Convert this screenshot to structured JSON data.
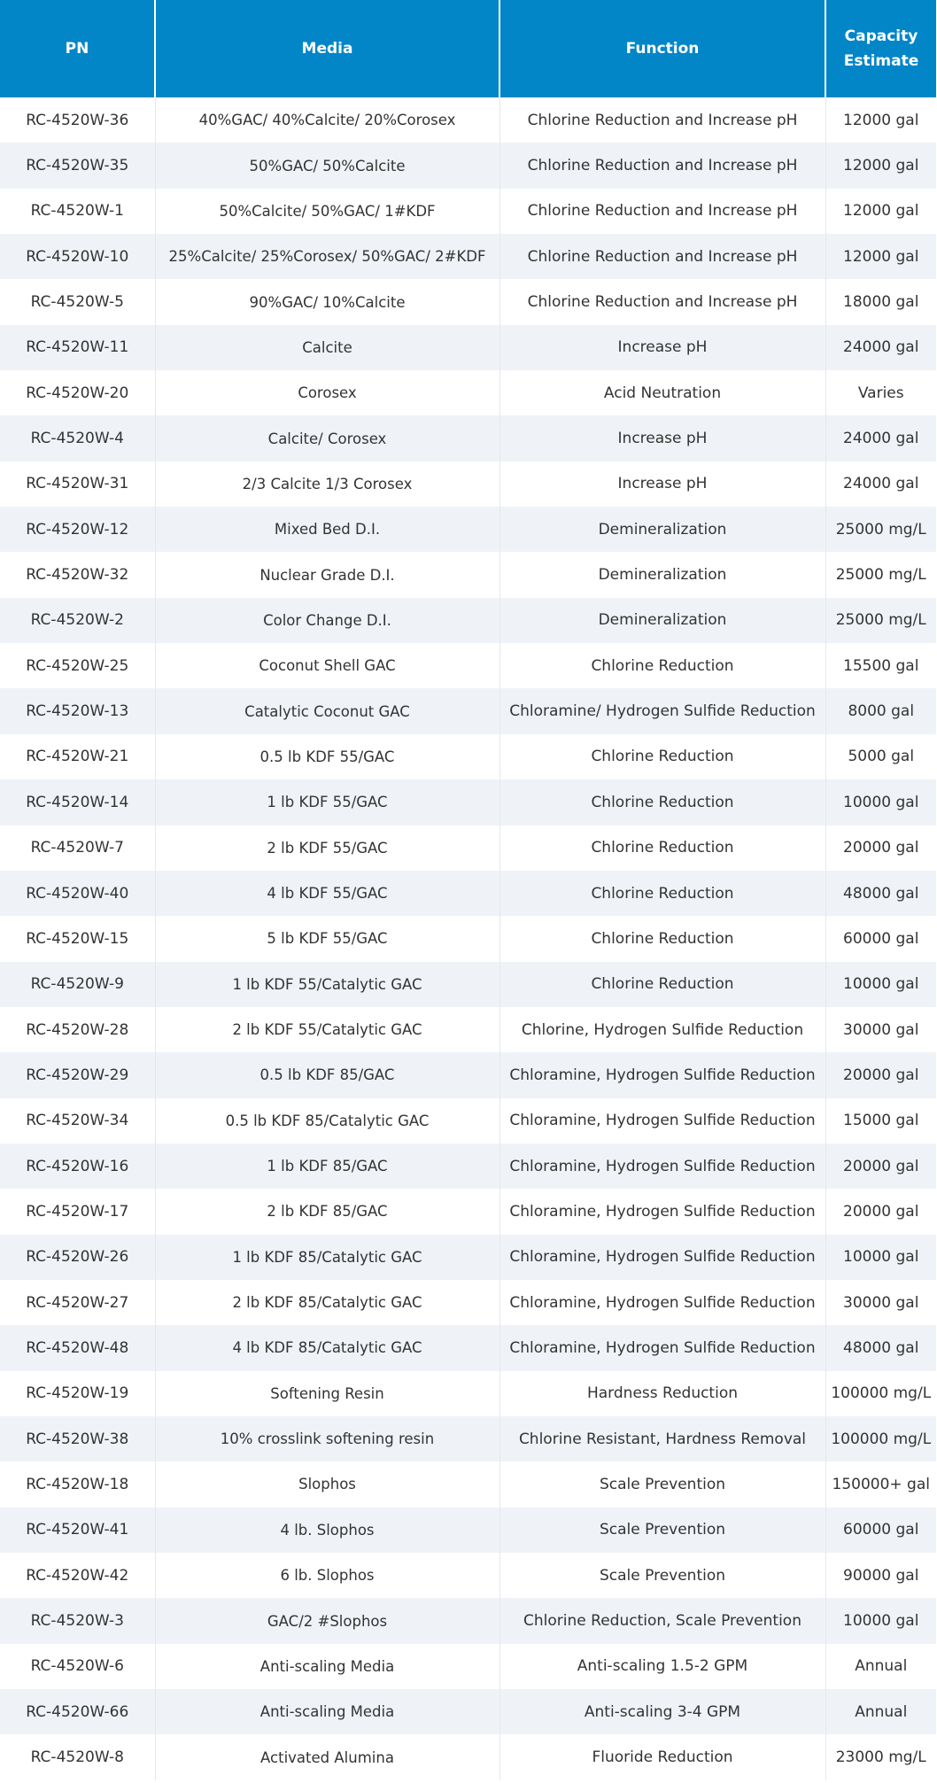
{
  "table": {
    "headers": {
      "pn": "PN",
      "media": "Media",
      "function": "Function",
      "capacity_line1": "Capacity",
      "capacity_line2": "Estimate"
    },
    "rows": [
      {
        "pn": "RC-4520W-36",
        "media": "40%GAC/ 40%Calcite/ 20%Corosex",
        "function": "Chlorine Reduction and Increase pH",
        "capacity": "12000 gal"
      },
      {
        "pn": "RC-4520W-35",
        "media": "50%GAC/ 50%Calcite",
        "function": "Chlorine Reduction and Increase pH",
        "capacity": "12000 gal"
      },
      {
        "pn": "RC-4520W-1",
        "media": "50%Calcite/ 50%GAC/ 1#KDF",
        "function": "Chlorine Reduction and Increase pH",
        "capacity": "12000 gal"
      },
      {
        "pn": "RC-4520W-10",
        "media": "25%Calcite/ 25%Corosex/ 50%GAC/ 2#KDF",
        "function": "Chlorine Reduction and Increase pH",
        "capacity": "12000 gal"
      },
      {
        "pn": "RC-4520W-5",
        "media": "90%GAC/ 10%Calcite",
        "function": "Chlorine Reduction and Increase pH",
        "capacity": "18000 gal"
      },
      {
        "pn": "RC-4520W-11",
        "media": "Calcite",
        "function": "Increase pH",
        "capacity": "24000 gal"
      },
      {
        "pn": "RC-4520W-20",
        "media": "Corosex",
        "function": "Acid Neutration",
        "capacity": "Varies"
      },
      {
        "pn": "RC-4520W-4",
        "media": "Calcite/ Corosex",
        "function": "Increase pH",
        "capacity": "24000 gal"
      },
      {
        "pn": "RC-4520W-31",
        "media": "2/3 Calcite 1/3 Corosex",
        "function": "Increase pH",
        "capacity": "24000 gal"
      },
      {
        "pn": "RC-4520W-12",
        "media": "Mixed Bed D.I.",
        "function": "Demineralization",
        "capacity": "25000 mg/L"
      },
      {
        "pn": "RC-4520W-32",
        "media": "Nuclear Grade D.I.",
        "function": "Demineralization",
        "capacity": "25000 mg/L"
      },
      {
        "pn": "RC-4520W-2",
        "media": "Color Change D.I.",
        "function": "Demineralization",
        "capacity": "25000 mg/L"
      },
      {
        "pn": "RC-4520W-25",
        "media": "Coconut Shell GAC",
        "function": "Chlorine Reduction",
        "capacity": "15500 gal"
      },
      {
        "pn": "RC-4520W-13",
        "media": "Catalytic Coconut GAC",
        "function": "Chloramine/ Hydrogen Sulfide Reduction",
        "capacity": "8000 gal"
      },
      {
        "pn": "RC-4520W-21",
        "media": "0.5 lb KDF 55/GAC",
        "function": "Chlorine Reduction",
        "capacity": "5000 gal"
      },
      {
        "pn": "RC-4520W-14",
        "media": "1 lb KDF 55/GAC",
        "function": "Chlorine Reduction",
        "capacity": "10000 gal"
      },
      {
        "pn": "RC-4520W-7",
        "media": "2 lb KDF 55/GAC",
        "function": "Chlorine Reduction",
        "capacity": "20000 gal"
      },
      {
        "pn": "RC-4520W-40",
        "media": "4 lb KDF 55/GAC",
        "function": "Chlorine Reduction",
        "capacity": "48000 gal"
      },
      {
        "pn": "RC-4520W-15",
        "media": "5 lb KDF 55/GAC",
        "function": "Chlorine Reduction",
        "capacity": "60000 gal"
      },
      {
        "pn": "RC-4520W-9",
        "media": "1 lb KDF 55/Catalytic GAC",
        "function": "Chlorine Reduction",
        "capacity": "10000 gal"
      },
      {
        "pn": "RC-4520W-28",
        "media": "2 lb KDF 55/Catalytic GAC",
        "function": "Chlorine, Hydrogen Sulfide Reduction",
        "capacity": "30000 gal"
      },
      {
        "pn": "RC-4520W-29",
        "media": "0.5 lb KDF 85/GAC",
        "function": "Chloramine, Hydrogen Sulfide Reduction",
        "capacity": "20000 gal"
      },
      {
        "pn": "RC-4520W-34",
        "media": "0.5 lb KDF 85/Catalytic GAC",
        "function": "Chloramine, Hydrogen Sulfide Reduction",
        "capacity": "15000 gal"
      },
      {
        "pn": "RC-4520W-16",
        "media": "1 lb KDF 85/GAC",
        "function": "Chloramine, Hydrogen Sulfide Reduction",
        "capacity": "20000 gal"
      },
      {
        "pn": "RC-4520W-17",
        "media": "2 lb KDF 85/GAC",
        "function": "Chloramine, Hydrogen Sulfide Reduction",
        "capacity": "20000 gal"
      },
      {
        "pn": "RC-4520W-26",
        "media": "1 lb KDF 85/Catalytic GAC",
        "function": "Chloramine, Hydrogen Sulfide Reduction",
        "capacity": "10000 gal"
      },
      {
        "pn": "RC-4520W-27",
        "media": "2 lb KDF 85/Catalytic GAC",
        "function": "Chloramine, Hydrogen Sulfide Reduction",
        "capacity": "30000 gal"
      },
      {
        "pn": "RC-4520W-48",
        "media": "4 lb KDF 85/Catalytic GAC",
        "function": "Chloramine, Hydrogen Sulfide Reduction",
        "capacity": "48000 gal"
      },
      {
        "pn": "RC-4520W-19",
        "media": "Softening Resin",
        "function": "Hardness Reduction",
        "capacity": "100000 mg/L"
      },
      {
        "pn": "RC-4520W-38",
        "media": "10% crosslink softening resin",
        "function": "Chlorine Resistant, Hardness Removal",
        "capacity": "100000 mg/L"
      },
      {
        "pn": "RC-4520W-18",
        "media": "Slophos",
        "function": "Scale Prevention",
        "capacity": "150000+ gal"
      },
      {
        "pn": "RC-4520W-41",
        "media": "4 lb. Slophos",
        "function": "Scale Prevention",
        "capacity": "60000 gal"
      },
      {
        "pn": "RC-4520W-42",
        "media": "6 lb. Slophos",
        "function": "Scale Prevention",
        "capacity": "90000 gal"
      },
      {
        "pn": "RC-4520W-3",
        "media": "GAC/2 #Slophos",
        "function": "Chlorine Reduction, Scale Prevention",
        "capacity": "10000 gal"
      },
      {
        "pn": "RC-4520W-6",
        "media": "Anti-scaling Media",
        "function": "Anti-scaling 1.5-2 GPM",
        "capacity": "Annual"
      },
      {
        "pn": "RC-4520W-66",
        "media": "Anti-scaling Media",
        "function": "Anti-scaling 3-4 GPM",
        "capacity": "Annual"
      },
      {
        "pn": "RC-4520W-8",
        "media": "Activated Alumina",
        "function": "Fluoride Reduction",
        "capacity": "23000 mg/L"
      }
    ]
  }
}
